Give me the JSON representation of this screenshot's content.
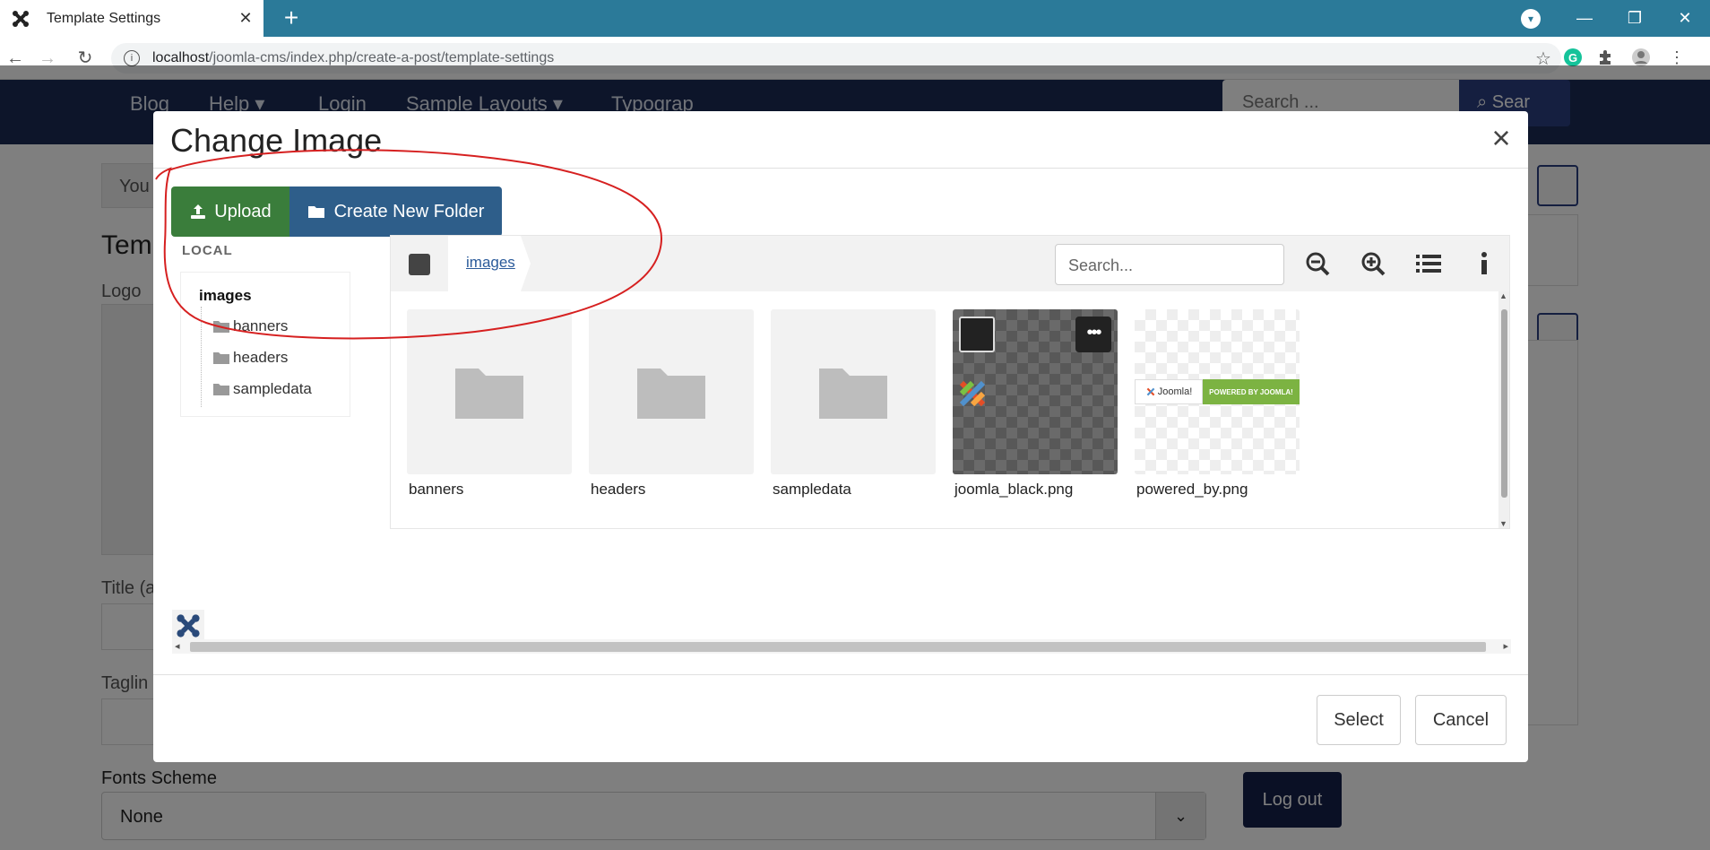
{
  "browser": {
    "tab_title": "Template Settings",
    "url_host": "localhost",
    "url_path": "/joomla-cms/index.php/create-a-post/template-settings"
  },
  "site": {
    "nav": [
      "Blog",
      "Help",
      "Login",
      "Sample Layouts",
      "Typograp"
    ],
    "search_placeholder": "Search ...",
    "search_button": "Sear",
    "bg_labels": {
      "you": "You",
      "temp": "Temp",
      "logo": "Logo",
      "title": "Title (a",
      "tagline": "Taglin",
      "fonts_scheme": "Fonts Scheme",
      "fonts_value": "None",
      "logout": "Log out"
    }
  },
  "modal": {
    "title": "Change Image",
    "upload_label": "Upload",
    "create_folder_label": "Create New Folder",
    "local_label": "LOCAL",
    "tree": {
      "root": "images",
      "children": [
        "banners",
        "headers",
        "sampledata"
      ]
    },
    "breadcrumb": "images",
    "search_placeholder": "Search...",
    "items": [
      {
        "name": "banners",
        "type": "folder"
      },
      {
        "name": "headers",
        "type": "folder"
      },
      {
        "name": "sampledata",
        "type": "folder"
      },
      {
        "name": "joomla_black.png",
        "type": "image"
      },
      {
        "name": "powered_by.png",
        "type": "image"
      }
    ],
    "powered_banner": {
      "left": "Joomla!",
      "right": "POWERED BY JOOMLA!"
    },
    "select_label": "Select",
    "cancel_label": "Cancel"
  },
  "colors": {
    "upload": "#3a7d3b",
    "create_folder": "#2e5e8a",
    "annotation": "#d62020"
  }
}
